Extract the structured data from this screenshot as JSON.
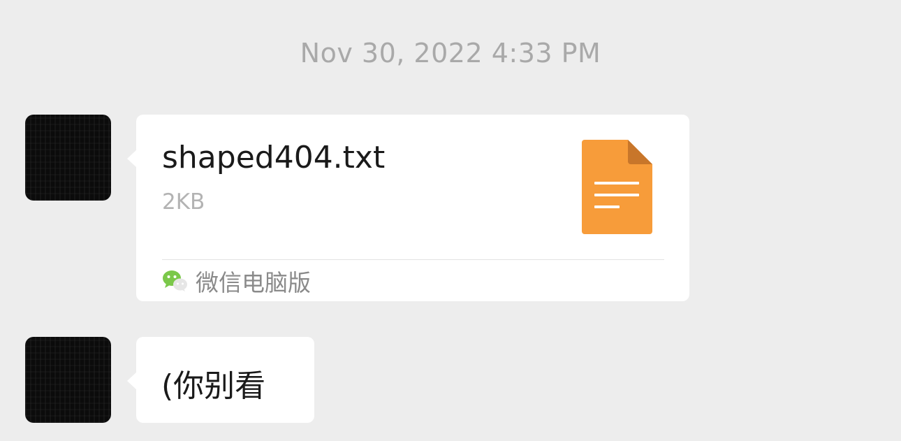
{
  "timestamp": "Nov 30, 2022 4:33 PM",
  "messages": [
    {
      "type": "file",
      "file_name": "shaped404.txt",
      "file_size": "2KB",
      "file_icon": "document-icon",
      "file_icon_color": "#f79c3a",
      "source_icon": "wechat-icon",
      "source_label": "微信电脑版"
    },
    {
      "type": "text",
      "text": "(你别看"
    }
  ],
  "colors": {
    "background": "#ededed",
    "bubble": "#ffffff",
    "timestamp": "#a9a9a9",
    "wechat_green": "#7bc84a"
  }
}
